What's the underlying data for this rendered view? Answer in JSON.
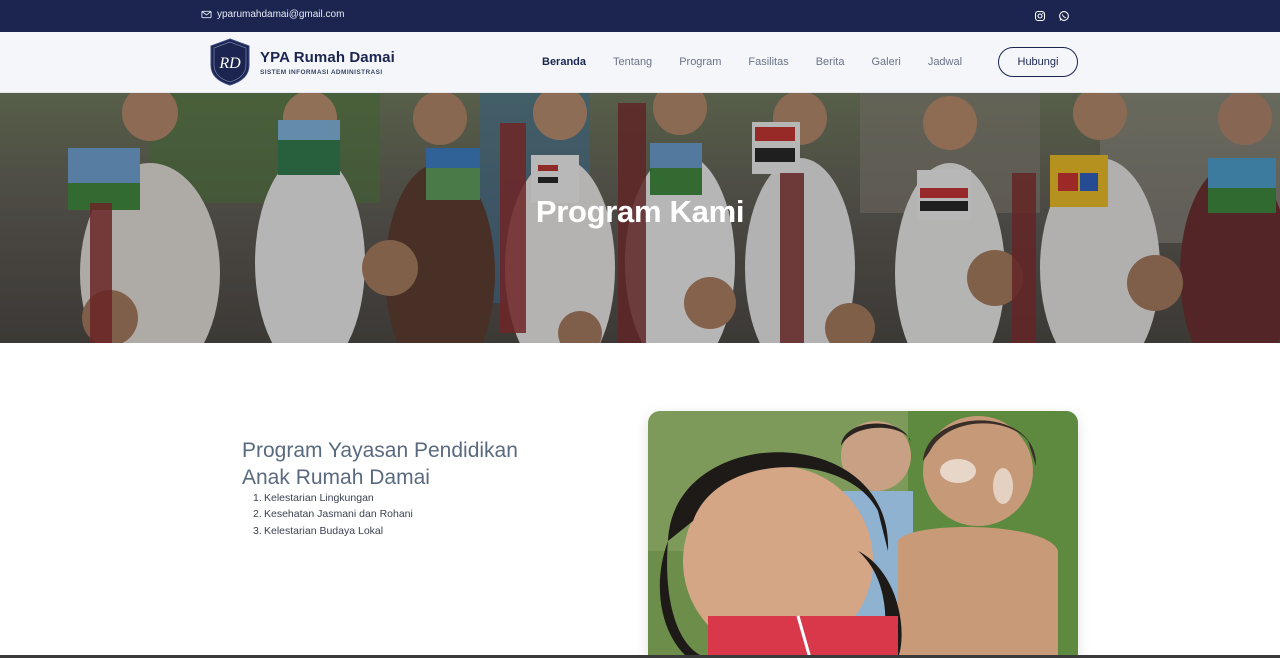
{
  "topbar": {
    "email": "yparumahdamai@gmail.com",
    "icons": [
      "mail-icon",
      "instagram-icon",
      "whatsapp-icon"
    ]
  },
  "header": {
    "brand_name": "YPA Rumah Damai",
    "brand_tagline": "SISTEM INFORMASI ADMINISTRASI",
    "logo_letters": "RD",
    "nav": [
      {
        "label": "Beranda",
        "active": true
      },
      {
        "label": "Tentang",
        "active": false
      },
      {
        "label": "Program",
        "active": false
      },
      {
        "label": "Fasilitas",
        "active": false
      },
      {
        "label": "Berita",
        "active": false
      },
      {
        "label": "Galeri",
        "active": false
      },
      {
        "label": "Jadwal",
        "active": false
      }
    ],
    "contact_label": "Hubungi"
  },
  "hero": {
    "title": "Program Kami"
  },
  "content": {
    "title_line1": "Program Yayasan Pendidikan",
    "title_line2": "Anak Rumah Damai",
    "list": [
      {
        "num": "1.",
        "text": "Kelestarian Lingkungan"
      },
      {
        "num": "2.",
        "text": "Kesehatan Jasmani dan Rohani"
      },
      {
        "num": "3.",
        "text": "Kelestarian Budaya Lokal"
      }
    ]
  },
  "colors": {
    "navy": "#1b2550",
    "heading_gray": "#5a6a7e",
    "header_bg": "#f4f6f9"
  }
}
